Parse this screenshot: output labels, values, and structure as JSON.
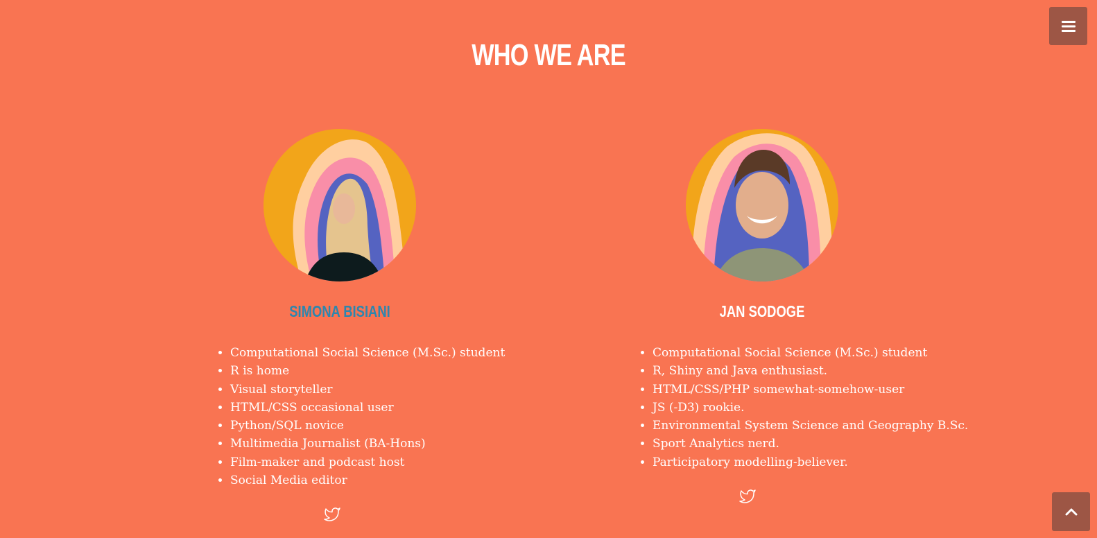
{
  "header": {
    "menu_icon": "hamburger-menu-icon",
    "title": "WHO WE ARE"
  },
  "colors": {
    "background": "#F97452",
    "button_bg": "#9D5645",
    "name_accent": "#2E86AE",
    "text": "#FFFFFF"
  },
  "members": [
    {
      "name": "SIMONA BISIANI",
      "photo": "portrait photo of a woman with long blond hair",
      "facts": [
        "Computational Social Science (M.Sc.) student",
        "R is home",
        "Visual storyteller",
        "HTML/CSS occasional user",
        "Python/SQL novice",
        "Multimedia Journalist (BA-Hons)",
        "Film-maker and podcast host",
        "Social Media editor"
      ],
      "social_icon": "twitter-icon"
    },
    {
      "name": "JAN SODOGE",
      "photo": "portrait photo of a smiling young man",
      "facts": [
        "Computational Social Science (M.Sc.) student",
        "R, Shiny and Java enthusiast.",
        "HTML/CSS/PHP somewhat-somehow-user",
        "JS (-D3) rookie.",
        "Environmental System Science and Geography B.Sc.",
        "Sport Analytics nerd.",
        "Participatory modelling-believer."
      ],
      "social_icon": "twitter-icon"
    }
  ],
  "footer": {
    "scroll_top_icon": "chevron-up-icon"
  }
}
